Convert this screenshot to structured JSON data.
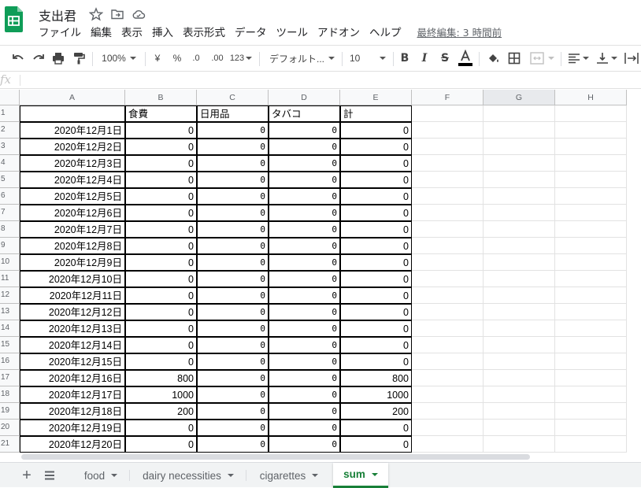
{
  "document": {
    "title": "支出君",
    "last_edit": "最終編集: 3 時間前"
  },
  "menu": [
    "ファイル",
    "編集",
    "表示",
    "挿入",
    "表示形式",
    "データ",
    "ツール",
    "アドオン",
    "ヘルプ"
  ],
  "toolbar": {
    "zoom": "100%",
    "currency": "¥",
    "percent": "%",
    "decrease_decimal": ".0",
    "increase_decimal": ".00",
    "number_format": "123",
    "font_family": "デフォルト...",
    "font_size": "10",
    "text_color_bar": "#000000"
  },
  "formula_bar": {
    "fx": "fx"
  },
  "columns": [
    "A",
    "B",
    "C",
    "D",
    "E",
    "F",
    "G",
    "H"
  ],
  "active_column": "G",
  "rows": [
    [
      "",
      "食費",
      "日用品",
      "タバコ",
      "計"
    ],
    [
      "2020年12月1日",
      "0",
      "0",
      "0",
      "0"
    ],
    [
      "2020年12月2日",
      "0",
      "0",
      "0",
      "0"
    ],
    [
      "2020年12月3日",
      "0",
      "0",
      "0",
      "0"
    ],
    [
      "2020年12月4日",
      "0",
      "0",
      "0",
      "0"
    ],
    [
      "2020年12月5日",
      "0",
      "0",
      "0",
      "0"
    ],
    [
      "2020年12月6日",
      "0",
      "0",
      "0",
      "0"
    ],
    [
      "2020年12月7日",
      "0",
      "0",
      "0",
      "0"
    ],
    [
      "2020年12月8日",
      "0",
      "0",
      "0",
      "0"
    ],
    [
      "2020年12月9日",
      "0",
      "0",
      "0",
      "0"
    ],
    [
      "2020年12月10日",
      "0",
      "0",
      "0",
      "0"
    ],
    [
      "2020年12月11日",
      "0",
      "0",
      "0",
      "0"
    ],
    [
      "2020年12月12日",
      "0",
      "0",
      "0",
      "0"
    ],
    [
      "2020年12月13日",
      "0",
      "0",
      "0",
      "0"
    ],
    [
      "2020年12月14日",
      "0",
      "0",
      "0",
      "0"
    ],
    [
      "2020年12月15日",
      "0",
      "0",
      "0",
      "0"
    ],
    [
      "2020年12月16日",
      "800",
      "0",
      "0",
      "800"
    ],
    [
      "2020年12月17日",
      "1000",
      "0",
      "0",
      "1000"
    ],
    [
      "2020年12月18日",
      "200",
      "0",
      "0",
      "200"
    ],
    [
      "2020年12月19日",
      "0",
      "0",
      "0",
      "0"
    ],
    [
      "2020年12月20日",
      "0",
      "0",
      "0",
      "0"
    ]
  ],
  "row_numbers": [
    "1",
    "2",
    "3",
    "4",
    "5",
    "6",
    "7",
    "8",
    "9",
    "10",
    "11",
    "12",
    "13",
    "14",
    "15",
    "16",
    "17",
    "18",
    "19",
    "20",
    "21"
  ],
  "sheets": [
    "food",
    "dairy necessities",
    "cigarettes",
    "sum"
  ],
  "active_sheet": "sum",
  "colors": {
    "brand_green": "#188038",
    "logo_green": "#0f9d58"
  }
}
